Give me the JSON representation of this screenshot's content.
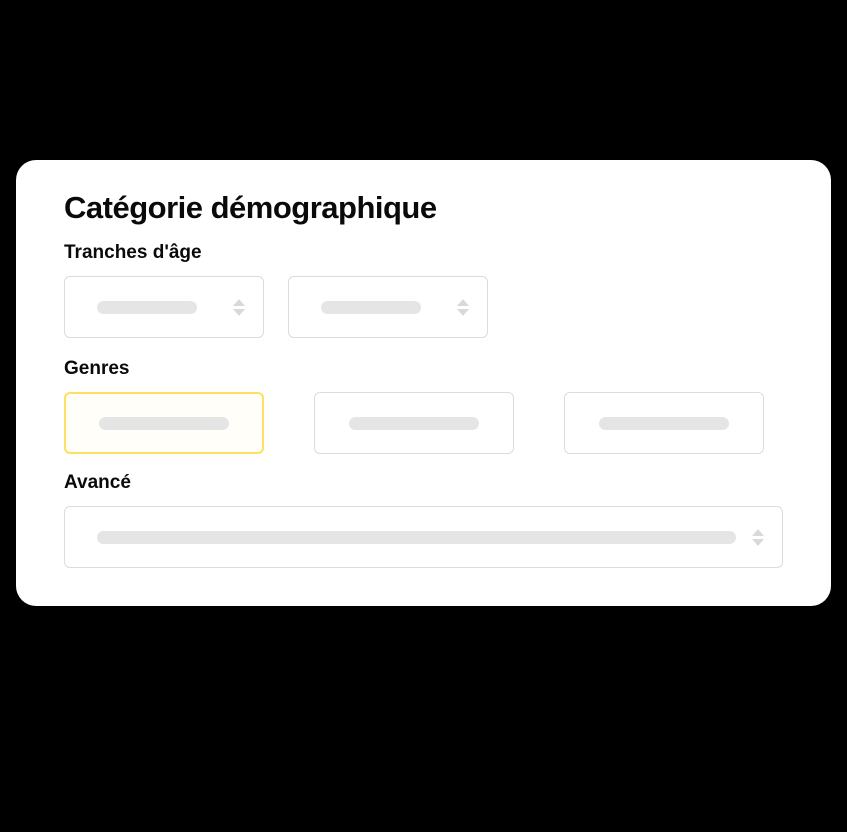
{
  "card": {
    "title": "Catégorie démographique",
    "sections": {
      "age": {
        "label": "Tranches d'âge"
      },
      "genres": {
        "label": "Genres"
      },
      "advanced": {
        "label": "Avancé"
      }
    }
  }
}
